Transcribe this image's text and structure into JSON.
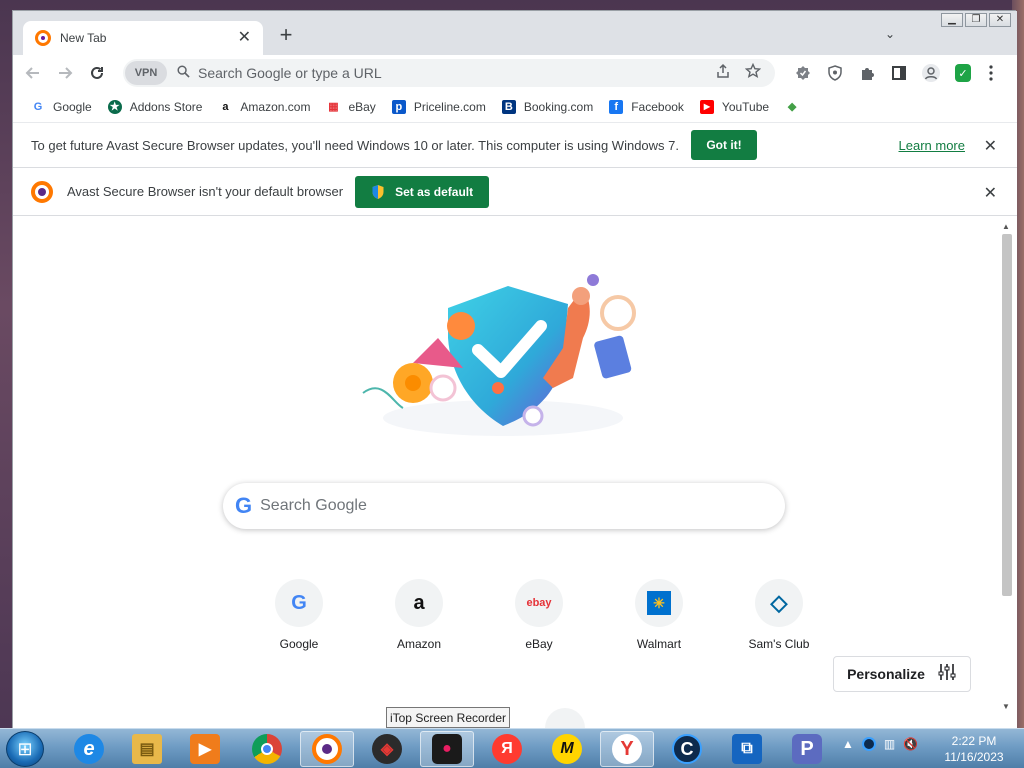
{
  "browser": {
    "tab": {
      "title": "New Tab",
      "close": "✕"
    },
    "new_tab": "+",
    "tab_search": "⌄",
    "window_controls": {
      "minimize": "▁",
      "restore": "❐",
      "close": "✕"
    },
    "toolbar": {
      "vpn": "VPN",
      "omnibox_placeholder": "Search Google or type a URL"
    },
    "bookmarks": [
      {
        "label": "Google",
        "icon": "G",
        "color": "#4285f4"
      },
      {
        "label": "Addons Store",
        "icon": "★",
        "color": "#0a6b4b"
      },
      {
        "label": "Amazon.com",
        "icon": "a",
        "color": "#111111"
      },
      {
        "label": "eBay",
        "icon": "▦",
        "color": "#e53238"
      },
      {
        "label": "Priceline.com",
        "icon": "p",
        "color": "#0a58ca"
      },
      {
        "label": "Booking.com",
        "icon": "B",
        "color": "#003580"
      },
      {
        "label": "Facebook",
        "icon": "f",
        "color": "#1877f2"
      },
      {
        "label": "YouTube",
        "icon": "▶",
        "color": "#ff0000"
      },
      {
        "label": "",
        "icon": "◆",
        "color": "#43a047"
      }
    ]
  },
  "infobars": {
    "update": {
      "message": "To get future Avast Secure Browser updates, you'll need Windows 10 or later. This computer is using Windows 7.",
      "button": "Got it!",
      "link": "Learn more"
    },
    "default_browser": {
      "message": "Avast Secure Browser isn't your default browser",
      "button": "Set as default"
    }
  },
  "newtab": {
    "search_placeholder": "Search Google",
    "shortcuts": [
      {
        "label": "Google",
        "icon": "G",
        "color": "#4285f4"
      },
      {
        "label": "Amazon",
        "icon": "a",
        "color": "#111111"
      },
      {
        "label": "eBay",
        "icon": "ebay",
        "color": "#e53238"
      },
      {
        "label": "Walmart",
        "icon": "✳",
        "color": "#ffc220"
      },
      {
        "label": "Sam's Club",
        "icon": "◇",
        "color": "#0067a0"
      }
    ],
    "personalize": "Personalize"
  },
  "tooltip": "iTop Screen Recorder",
  "taskbar": {
    "apps": [
      {
        "name": "internet-explorer",
        "glyph": "e",
        "color": "#1e88e5"
      },
      {
        "name": "file-explorer",
        "glyph": "▤",
        "color": "#e8b84a"
      },
      {
        "name": "media-player",
        "glyph": "▶",
        "color": "#f07c1b"
      },
      {
        "name": "chrome",
        "glyph": "◉",
        "color": "#db4437"
      },
      {
        "name": "avast-browser",
        "glyph": "◎",
        "color": "#ff7800"
      },
      {
        "name": "recorder-app",
        "glyph": "◈",
        "color": "#c62828"
      },
      {
        "name": "itop-screen-recorder",
        "glyph": "●",
        "color": "#d81b60"
      },
      {
        "name": "yandex",
        "glyph": "Я",
        "color": "#ff3b30"
      },
      {
        "name": "m-app",
        "glyph": "M",
        "color": "#ffd400"
      },
      {
        "name": "yandex-browser",
        "glyph": "Y",
        "color": "#e53935"
      },
      {
        "name": "ccleaner",
        "glyph": "C",
        "color": "#0d47a1"
      },
      {
        "name": "remote-app",
        "glyph": "⧉",
        "color": "#1565c0"
      },
      {
        "name": "p-app",
        "glyph": "P",
        "color": "#5c6bc0"
      }
    ],
    "clock_time": "2:22 PM",
    "clock_date": "11/16/2023"
  }
}
